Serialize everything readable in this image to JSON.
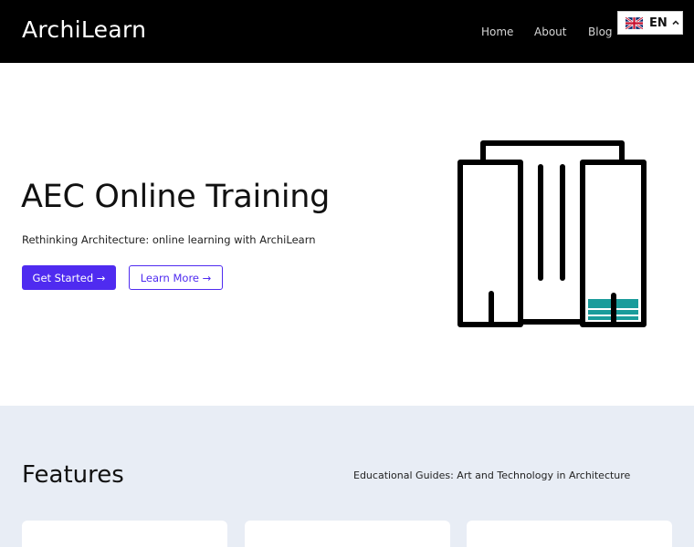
{
  "header": {
    "logo": "ArchiLearn",
    "nav": {
      "home": "Home",
      "about": "About",
      "blog": "Blog"
    },
    "language": {
      "code": "EN",
      "flag_icon": "uk-flag-icon",
      "chevron_icon": "chevron-up-icon"
    }
  },
  "hero": {
    "title": "AEC Online Training",
    "subtitle": "Rethinking Architecture: online learning with ArchiLearn",
    "primary_button": "Get Started →",
    "secondary_button": "Learn More →",
    "illustration_icon": "building-icon"
  },
  "features": {
    "title": "Features",
    "subtitle": "Educational Guides: Art and Technology in Architecture"
  },
  "colors": {
    "header_bg": "#000000",
    "accent": "#4f2bf0",
    "features_bg": "#e8edf5",
    "teal": "#1a9c9b"
  }
}
